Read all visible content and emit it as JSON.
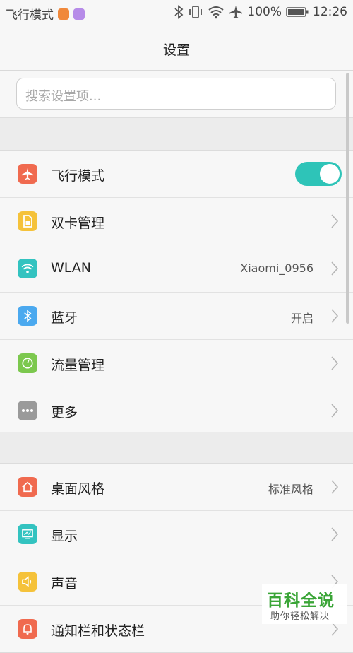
{
  "status_bar": {
    "left_text": "飞行模式",
    "battery": "100%",
    "time": "12:26"
  },
  "header": {
    "title": "设置"
  },
  "search": {
    "placeholder": "搜索设置项..."
  },
  "colors": {
    "airplane": "#f06a4f",
    "dual_sim": "#f5c23a",
    "wlan": "#33c3c0",
    "bluetooth": "#4ba9ef",
    "data": "#7cc84e",
    "more": "#9a9a9a",
    "desktop": "#f06a4f",
    "display": "#33c3c0",
    "sound": "#f5c23a",
    "toggle_on": "#2ec4b8"
  },
  "groups": [
    {
      "items": [
        {
          "label": "飞行模式",
          "icon": "airplane-icon",
          "toggle": true
        },
        {
          "label": "双卡管理",
          "icon": "sim-card-icon"
        },
        {
          "label": "WLAN",
          "icon": "wifi-icon",
          "value": "Xiaomi_0956"
        },
        {
          "label": "蓝牙",
          "icon": "bluetooth-icon",
          "value": "开启"
        },
        {
          "label": "流量管理",
          "icon": "data-usage-icon"
        },
        {
          "label": "更多",
          "icon": "more-icon"
        }
      ]
    },
    {
      "items": [
        {
          "label": "桌面风格",
          "icon": "home-icon",
          "value": "标准风格"
        },
        {
          "label": "显示",
          "icon": "display-icon"
        },
        {
          "label": "声音",
          "icon": "sound-icon"
        },
        {
          "label": "通知栏和状态栏",
          "icon": "notification-icon"
        }
      ]
    }
  ],
  "watermark": {
    "title": "百科全说",
    "subtitle": "助你轻松解决"
  }
}
